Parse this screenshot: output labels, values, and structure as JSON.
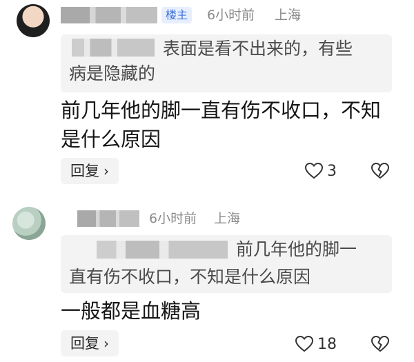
{
  "comments": [
    {
      "author_badge": "楼主",
      "time": "6小时前",
      "location": "上海",
      "quote_text_line1": "表面是看不出来的，有些",
      "quote_text_line2": "病是隐藏的",
      "content_line1": "前几年他的脚一直有伤不收口，不知",
      "content_line2": "是什么原因",
      "reply_label": "回复",
      "like_count": "3"
    },
    {
      "time": "6小时前",
      "location": "上海",
      "quote_text_line1": "前几年他的脚一",
      "quote_text_line2": "直有伤不收口，不知是什么原因",
      "content": "一般都是血糖高",
      "reply_label": "回复",
      "like_count": "18"
    }
  ],
  "icons": {
    "like": "heart-outline-icon",
    "dislike": "broken-heart-icon",
    "chevron": "chevron-right-icon"
  },
  "colors": {
    "badge_text": "#3a6fd8",
    "badge_bg": "#e7efff",
    "meta_text": "#8a8a8a",
    "quote_bg": "#f3f3f3"
  }
}
